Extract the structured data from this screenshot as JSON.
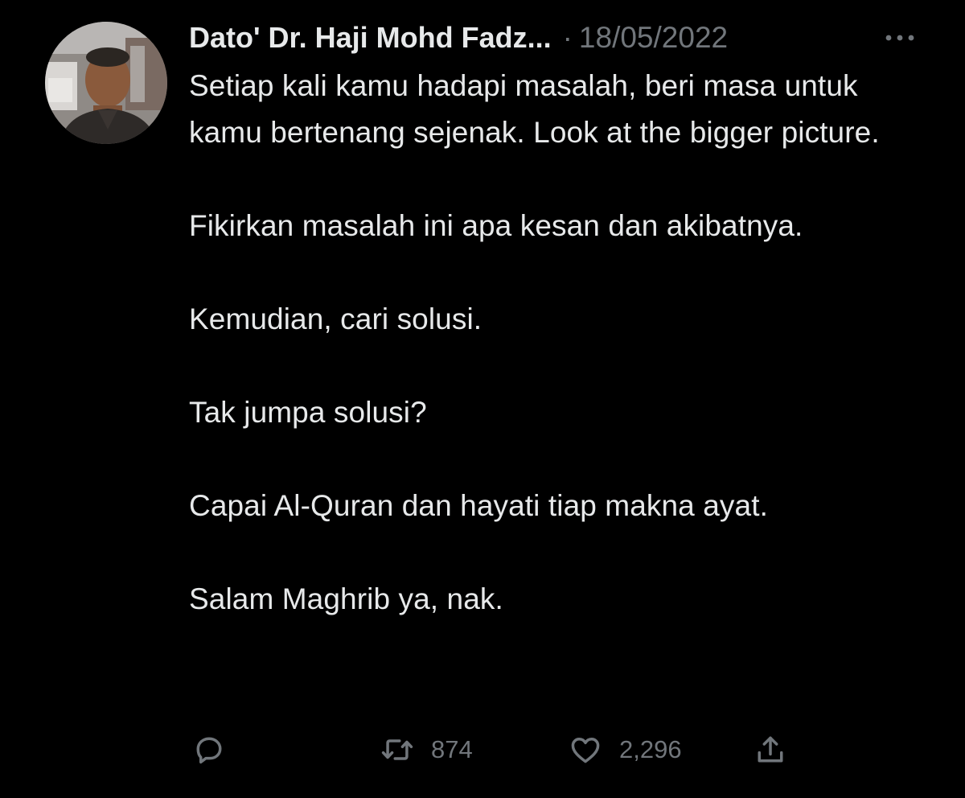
{
  "tweet": {
    "author_name": "Dato' Dr. Haji Mohd Fadz...",
    "separator": "·",
    "date": "18/05/2022",
    "more_icon": "more-horizontal-icon",
    "body": [
      "Setiap kali kamu hadapi masalah, beri masa untuk kamu bertenang sejenak. Look at the bigger picture.",
      "Fikirkan masalah ini apa kesan dan akibatnya.",
      "Kemudian, cari solusi.",
      "Tak jumpa solusi?",
      "Capai Al-Quran dan hayati tiap makna ayat.",
      "Salam Maghrib ya, nak."
    ]
  },
  "actions": {
    "reply": {
      "icon": "reply-icon"
    },
    "retweet": {
      "icon": "retweet-icon",
      "count": "874"
    },
    "like": {
      "icon": "heart-icon",
      "count": "2,296"
    },
    "share": {
      "icon": "share-icon"
    }
  },
  "colors": {
    "background": "#000000",
    "text_primary": "#e7e9ea",
    "text_secondary": "#71767b"
  }
}
